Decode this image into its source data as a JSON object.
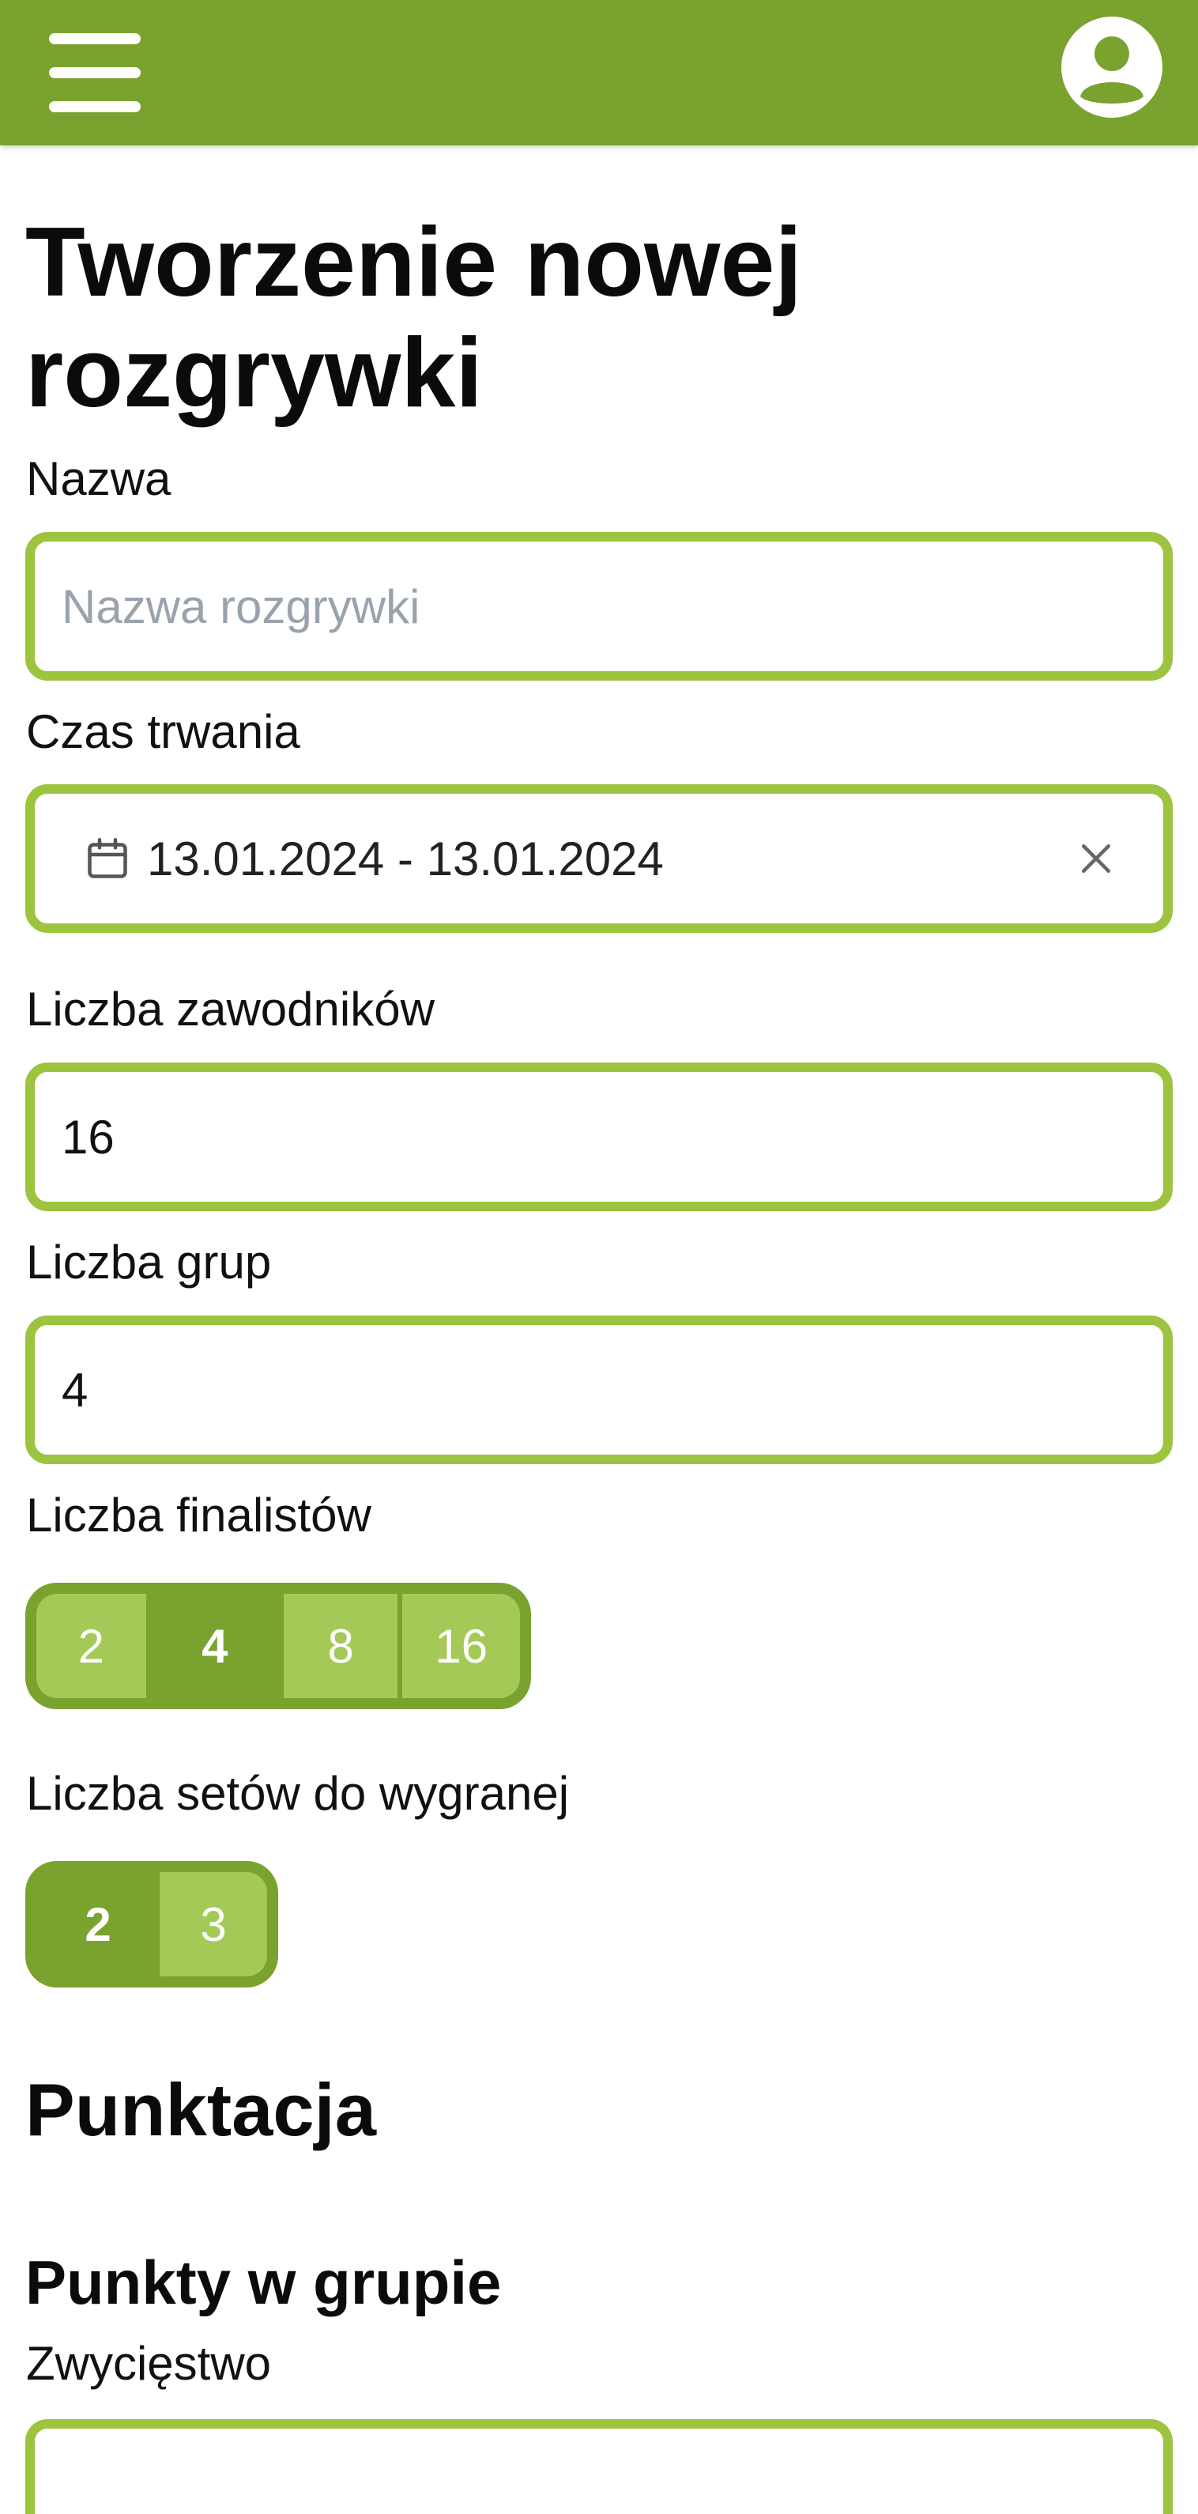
{
  "header": {
    "menu_icon": "hamburger-menu-icon",
    "profile_icon": "account-circle-icon",
    "accent_color": "#79a22f"
  },
  "page": {
    "title": "Tworzenie nowej rozgrywki"
  },
  "form": {
    "name": {
      "label": "Nazwa",
      "placeholder": "Nazwa rozgrywki",
      "value": ""
    },
    "duration": {
      "label": "Czas trwania",
      "value": "13.01.2024 - 13.01.2024",
      "icon": "calendar-icon",
      "clear_icon": "close-icon"
    },
    "players": {
      "label": "Liczba zawodników",
      "value": "16"
    },
    "groups": {
      "label": "Liczba grup",
      "value": "4"
    },
    "finalists": {
      "label": "Liczba finalistów",
      "options": [
        "2",
        "4",
        "8",
        "16"
      ],
      "selected": "4"
    },
    "sets": {
      "label": "Liczba setów do wygranej",
      "options": [
        "2",
        "3"
      ],
      "selected": "2"
    }
  },
  "scoring": {
    "title": "Punktacja",
    "group_points": {
      "title": "Punkty w grupie",
      "win_label": "Zwycięstwo"
    }
  },
  "colors": {
    "topbar": "#79a22f",
    "input_border": "#9cc43e",
    "segment_selected": "#79a22f",
    "segment_unselected": "#a5c957"
  }
}
